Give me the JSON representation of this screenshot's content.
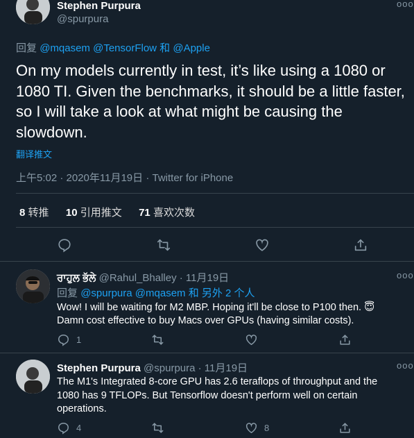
{
  "main_tweet": {
    "author_name": "Stephen Purpura",
    "handle": "@spurpura",
    "reply_prefix": "回复",
    "reply_to": "@mqasem @TensorFlow 和 @Apple",
    "text_lines": [
      "On my models currently in test, it’s like using a 1080 or",
      "1080 TI. Given the benchmarks, it should be a little faster,",
      "so I will take a look at what might be causing the",
      "slowdown."
    ],
    "translate": "翻译推文",
    "meta": "上午5:02 · 2020年11月19日 · Twitter for iPhone",
    "stats": {
      "retweets_count": "8",
      "retweets_label": "转推",
      "quotes_count": "10",
      "quotes_label": "引用推文",
      "likes_count": "71",
      "likes_label": "喜欢次数"
    }
  },
  "replies": [
    {
      "author_name": "ਰਾਹੁਲ ਭੱਲੇ",
      "handle": "@Rahul_Bhalley",
      "date": "· 11月19日",
      "reply_prefix": "回复",
      "reply_to": "@spurpura @mqasem 和 另外 2 个人",
      "text_lines": [
        "Wow! I will be waiting for M2 MBP. Hoping it'll be close to P100 then. 😇",
        "Damn cost effective to buy Macs over GPUs (having similar costs)."
      ],
      "reply_count": "1",
      "retweet_count": "",
      "like_count": ""
    },
    {
      "author_name": "Stephen Purpura",
      "handle": "@spurpura",
      "date": "· 11月19日",
      "text_lines": [
        "The M1's Integrated 8-core GPU has 2.6 teraflops of throughput and the",
        "1080 has 9 TFLOPs. But Tensorflow doesn't perform well on certain",
        "operations."
      ],
      "reply_count": "4",
      "retweet_count": "",
      "like_count": "8"
    }
  ],
  "more_glyph": "ooo",
  "colors": {
    "background": "#15202b",
    "accent": "#1da1f2",
    "muted": "#8899a6",
    "border": "#38444d"
  }
}
